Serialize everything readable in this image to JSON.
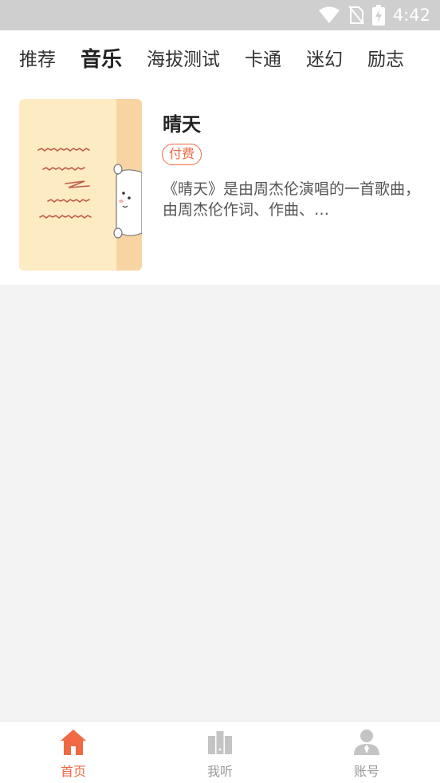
{
  "status_bar": {
    "time": "4:42"
  },
  "tabs": [
    {
      "label": "推荐",
      "active": false
    },
    {
      "label": "音乐",
      "active": true
    },
    {
      "label": "海拔测试",
      "active": false
    },
    {
      "label": "卡通",
      "active": false
    },
    {
      "label": "迷幻",
      "active": false
    },
    {
      "label": "励志",
      "active": false
    }
  ],
  "items": [
    {
      "title": "晴天",
      "badge": "付费",
      "description": "《晴天》是由周杰伦演唱的一首歌曲，由周杰伦作词、作曲、…"
    }
  ],
  "bottom_nav": [
    {
      "label": "首页",
      "icon": "home-icon",
      "active": true
    },
    {
      "label": "我听",
      "icon": "library-icon",
      "active": false
    },
    {
      "label": "账号",
      "icon": "account-icon",
      "active": false
    }
  ],
  "colors": {
    "accent": "#ef6a44",
    "status_bar": "#cfcfcf",
    "inactive_icon": "#c4c4c4"
  }
}
